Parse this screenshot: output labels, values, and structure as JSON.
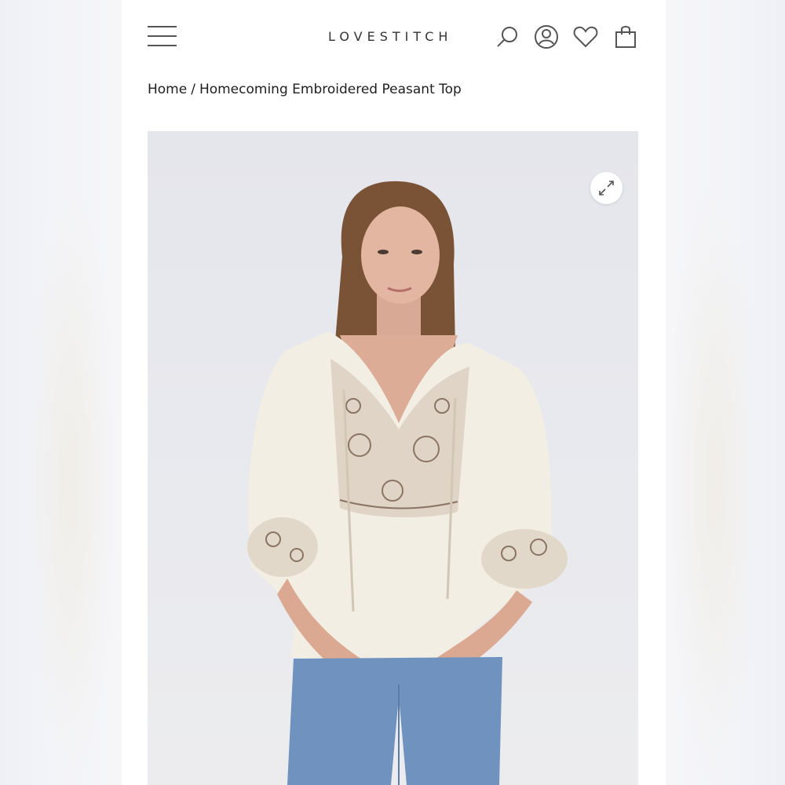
{
  "header": {
    "logo": "LOVESTITCH",
    "icons": [
      "menu-icon",
      "search-icon",
      "account-icon",
      "wishlist-icon",
      "bag-icon"
    ]
  },
  "breadcrumb": {
    "home": "Home",
    "separator": "/",
    "current": "Homecoming Embroidered Peasant Top"
  },
  "product": {
    "image_alt": "Homecoming Embroidered Peasant Top",
    "expand_icon": "expand-icon"
  },
  "colors": {
    "text": "#1e1e1e",
    "icon": "#555555",
    "image_bg": "#e7e8ed"
  }
}
